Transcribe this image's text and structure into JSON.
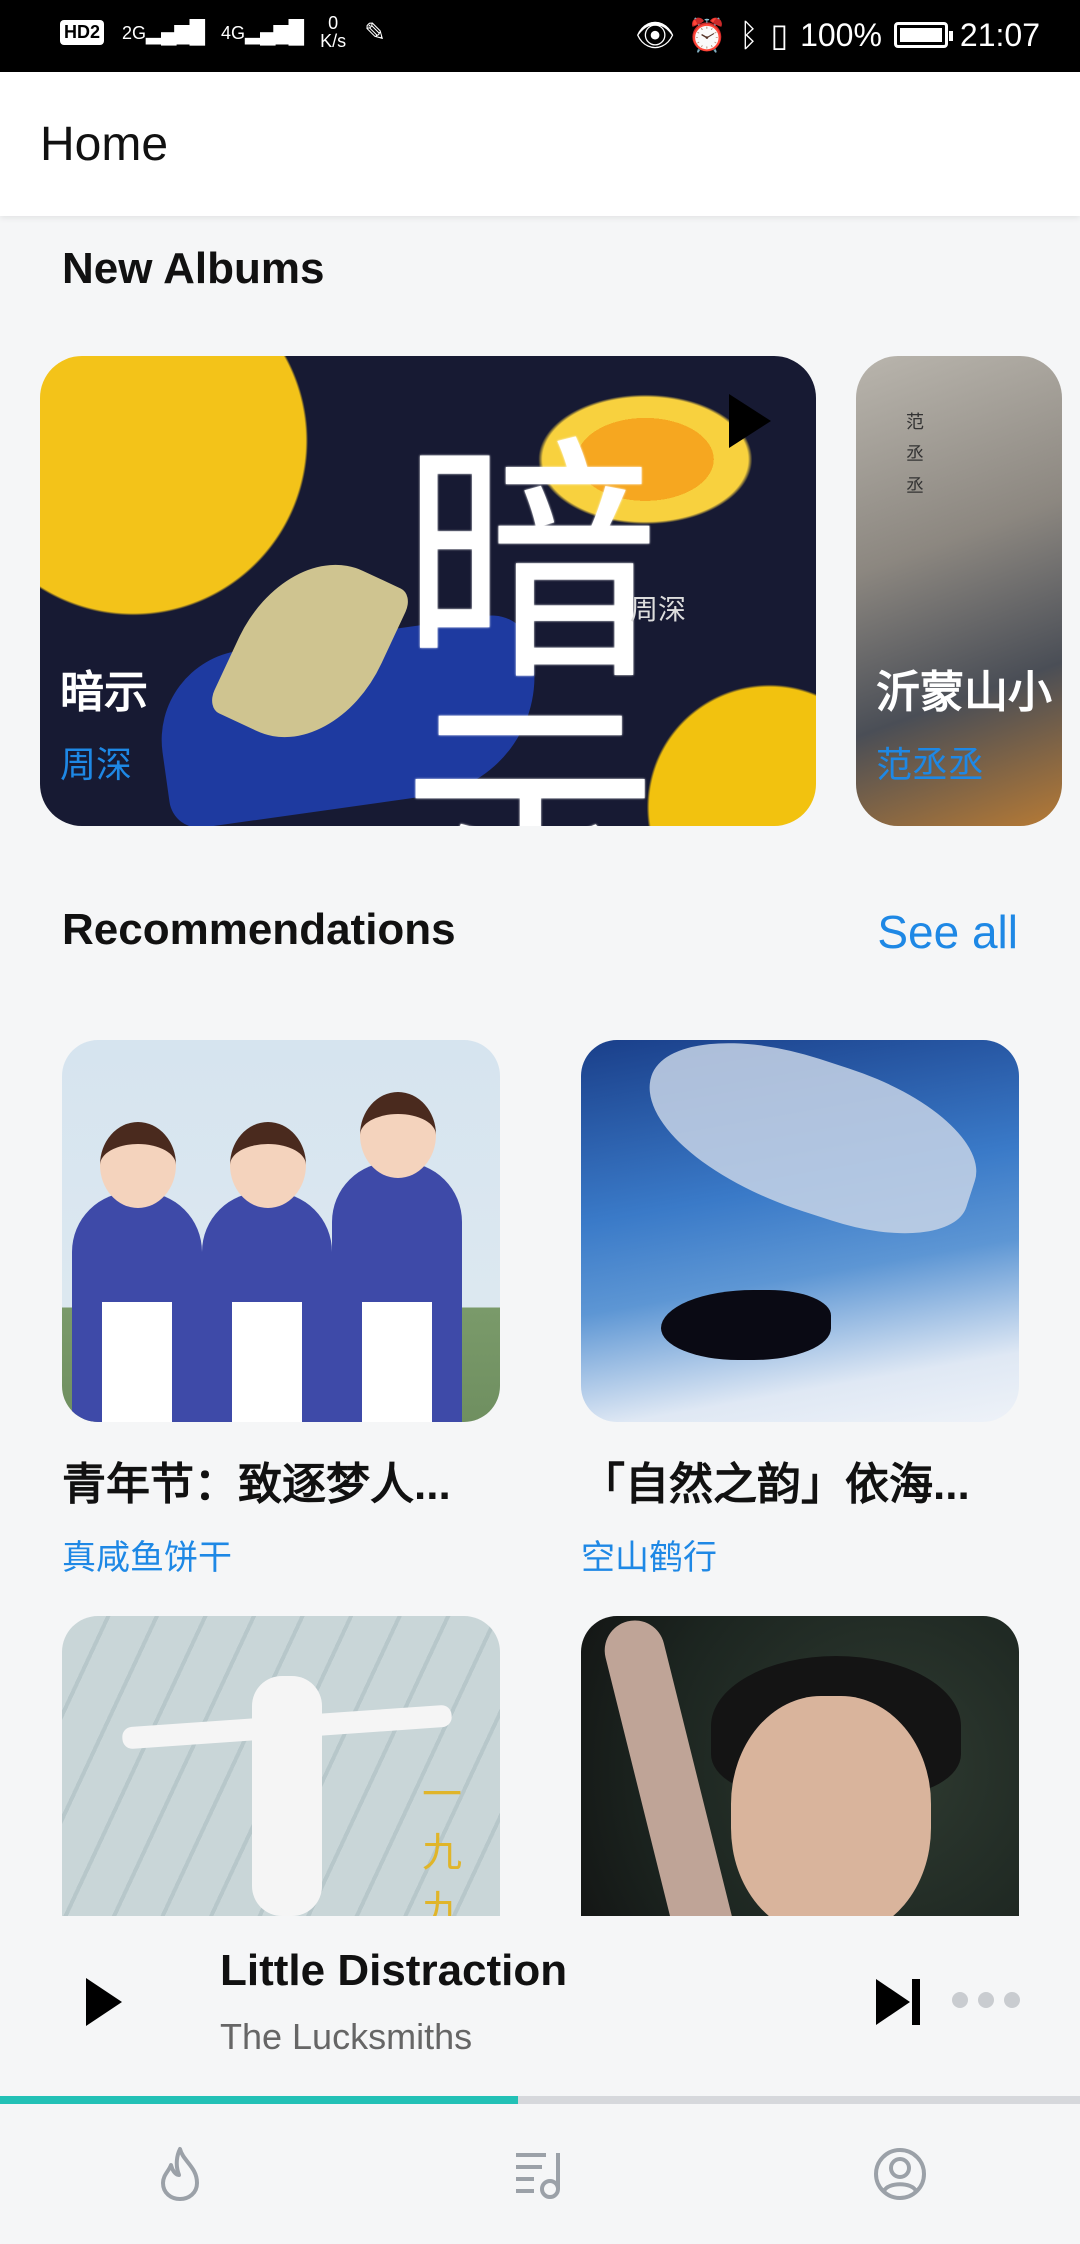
{
  "status_bar": {
    "hd": "HD",
    "hd_sub": "2",
    "net_2g": "2G",
    "net_4g": "4G",
    "speed_value": "0",
    "speed_unit": "K/s",
    "battery": "100%",
    "time": "21:07"
  },
  "app_bar": {
    "title": "Home"
  },
  "new_albums": {
    "heading": "New Albums",
    "albums": [
      {
        "title": "暗示",
        "artist": "周深",
        "cover_glyph": "暗示",
        "cover_mark": "周深"
      },
      {
        "title": "沂蒙山小",
        "artist": "范丞丞",
        "cover_text": "范丞丞"
      }
    ]
  },
  "recommendations": {
    "heading": "Recommendations",
    "see_all": "See all",
    "items": [
      {
        "title": "青年节：致逐梦人...",
        "artist": "真咸鱼饼干"
      },
      {
        "title": "「自然之韵」依海...",
        "artist": "空山鹤行"
      },
      {
        "title": "",
        "artist": "",
        "cover_text": "一九九"
      },
      {
        "title": "",
        "artist": ""
      }
    ]
  },
  "player": {
    "title": "Little Distraction",
    "artist": "The Lucksmiths",
    "progress": 0.48
  },
  "bottom_nav": [
    {
      "icon": "flame-icon"
    },
    {
      "icon": "playlist-icon"
    },
    {
      "icon": "profile-icon"
    }
  ],
  "colors": {
    "accent": "#1e88e5",
    "progress": "#22c1b6"
  }
}
